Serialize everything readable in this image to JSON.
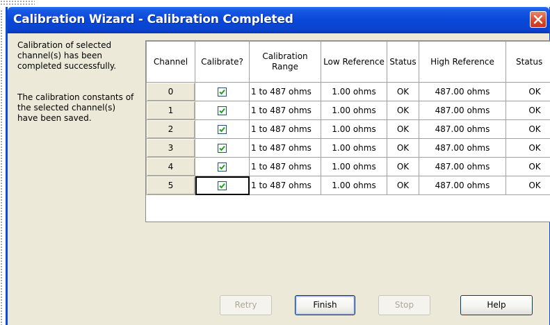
{
  "window": {
    "title": "Calibration Wizard - Calibration Completed"
  },
  "message": {
    "line1": "Calibration of selected channel(s) has been completed successfully.",
    "line2": "The calibration constants of the selected channel(s) have been saved."
  },
  "table": {
    "headers": {
      "channel": "Channel",
      "calibrate": "Calibrate?",
      "range": "Calibration Range",
      "low_ref": "Low Reference",
      "low_status": "Status",
      "high_ref": "High Reference",
      "high_status": "Status"
    },
    "rows": [
      {
        "channel": "0",
        "calibrate": true,
        "range": "1 to 487 ohms",
        "low_ref": "1.00 ohms",
        "low_status": "OK",
        "high_ref": "487.00 ohms",
        "high_status": "OK"
      },
      {
        "channel": "1",
        "calibrate": true,
        "range": "1 to 487 ohms",
        "low_ref": "1.00 ohms",
        "low_status": "OK",
        "high_ref": "487.00 ohms",
        "high_status": "OK"
      },
      {
        "channel": "2",
        "calibrate": true,
        "range": "1 to 487 ohms",
        "low_ref": "1.00 ohms",
        "low_status": "OK",
        "high_ref": "487.00 ohms",
        "high_status": "OK"
      },
      {
        "channel": "3",
        "calibrate": true,
        "range": "1 to 487 ohms",
        "low_ref": "1.00 ohms",
        "low_status": "OK",
        "high_ref": "487.00 ohms",
        "high_status": "OK"
      },
      {
        "channel": "4",
        "calibrate": true,
        "range": "1 to 487 ohms",
        "low_ref": "1.00 ohms",
        "low_status": "OK",
        "high_ref": "487.00 ohms",
        "high_status": "OK"
      },
      {
        "channel": "5",
        "calibrate": true,
        "range": "1 to 487 ohms",
        "low_ref": "1.00 ohms",
        "low_status": "OK",
        "high_ref": "487.00 ohms",
        "high_status": "OK"
      }
    ]
  },
  "buttons": {
    "retry": "Retry",
    "finish": "Finish",
    "stop": "Stop",
    "help": "Help"
  },
  "colors": {
    "titlebar": "#0a47d8",
    "face": "#ece9d8",
    "check": "#21a121",
    "close": "#d9472a"
  },
  "icons": {
    "close": "close-icon",
    "checkbox": "checkmark-icon"
  }
}
